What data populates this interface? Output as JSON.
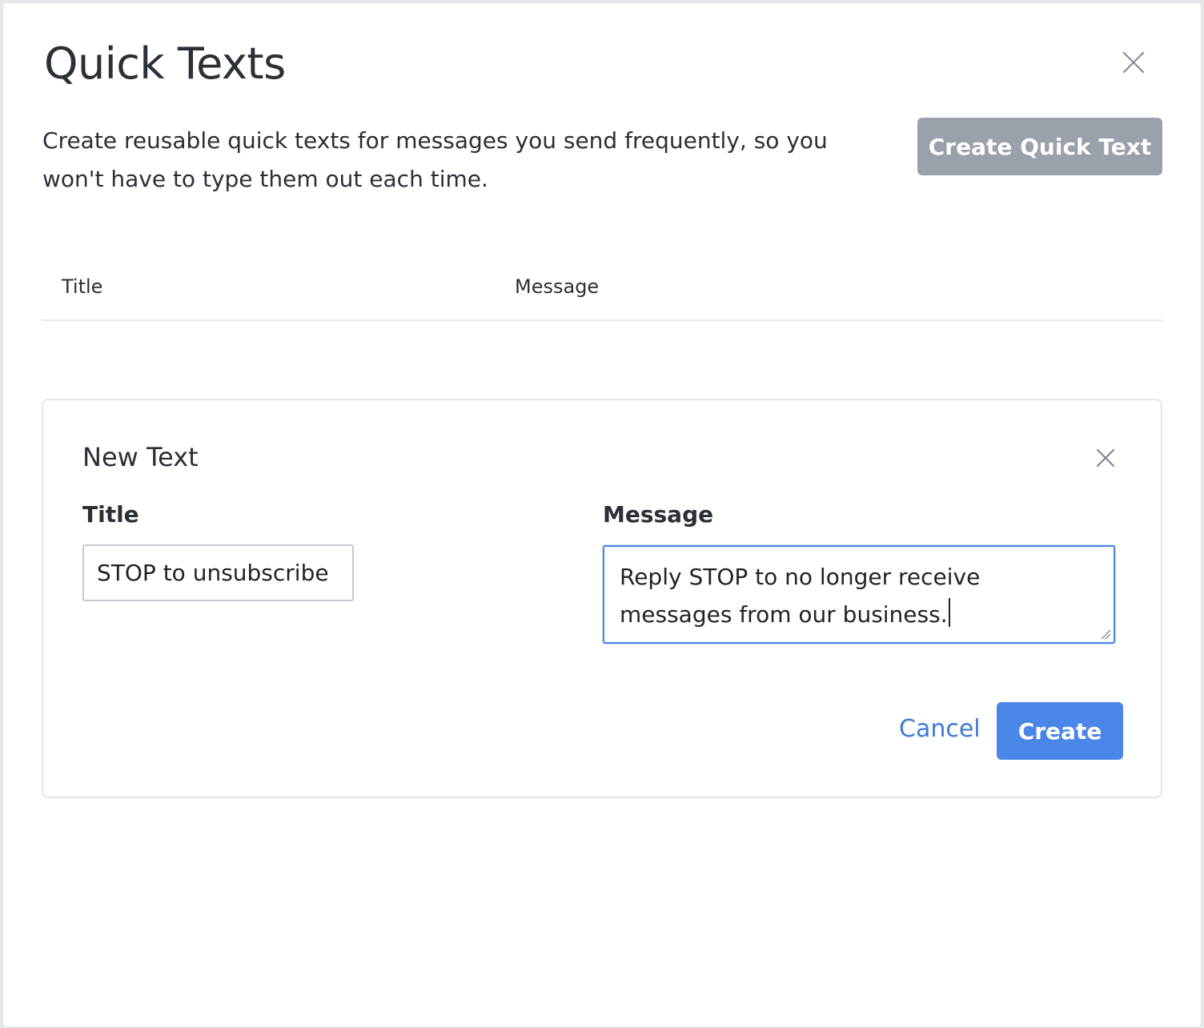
{
  "modal": {
    "title": "Quick Texts",
    "description": "Create reusable quick texts for messages you send frequently, so you won't have to type them out each time.",
    "create_button_label": "Create Quick Text",
    "close_icon": "close-icon"
  },
  "table": {
    "columns": [
      "Title",
      "Message"
    ]
  },
  "new_text_form": {
    "heading": "New Text",
    "close_icon": "close-icon",
    "title_label": "Title",
    "title_value": "STOP to unsubscribe",
    "message_label": "Message",
    "message_value": "Reply STOP to no longer receive messages from our business.",
    "cancel_label": "Cancel",
    "create_label": "Create"
  },
  "colors": {
    "primary": "#4a86e8",
    "disabled_button": "#9aa1aa",
    "link": "#3f7bd6"
  }
}
